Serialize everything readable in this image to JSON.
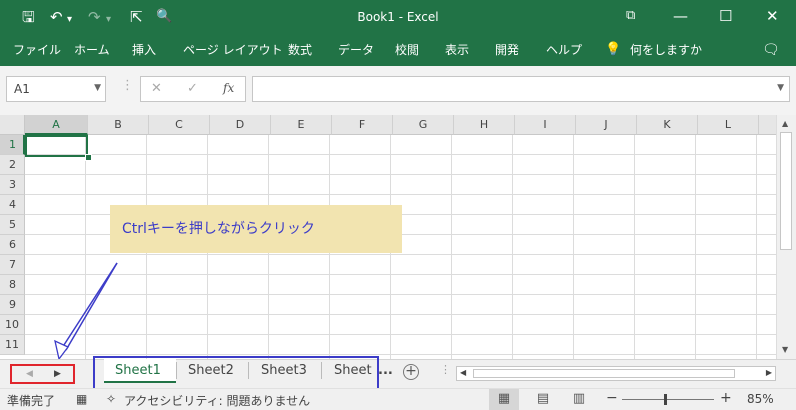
{
  "window": {
    "title": "Book1  -  Excel",
    "qa_icons": [
      "save-icon",
      "undo-icon",
      "undo-dropdown-icon",
      "redo-icon",
      "redo-dropdown-icon",
      "touch-mode-icon",
      "print-preview-icon"
    ],
    "qa_glyphs": {
      "save": "🖫",
      "undo": "↶",
      "undo_dd": "▾",
      "redo": "↷",
      "redo_dd": "▾",
      "touch": "⇱",
      "preview": "🔍"
    },
    "controls": {
      "restore": "⧉",
      "minimize": "—",
      "maximize": "☐",
      "close": "✕"
    }
  },
  "ribbon_tabs": [
    "ファイル",
    "ホーム",
    "挿入",
    "ページ レイアウト",
    "数式",
    "データ",
    "校閲",
    "表示",
    "開発",
    "ヘルプ"
  ],
  "tell_me": {
    "icon": "💡",
    "label": "何をしますか"
  },
  "share_icon": "🗨",
  "formula_bar": {
    "name_box": "A1",
    "cancel": "✕",
    "enter": "✓",
    "fx": "fx",
    "content": ""
  },
  "columns": [
    "A",
    "B",
    "C",
    "D",
    "E",
    "F",
    "G",
    "H",
    "I",
    "J",
    "K",
    "L"
  ],
  "rows": [
    "1",
    "2",
    "3",
    "4",
    "5",
    "6",
    "7",
    "8",
    "9",
    "10",
    "11"
  ],
  "active_cell": "A1",
  "callout": {
    "text": "Ctrlキーを押しながらクリック",
    "color": "#3c3cc8",
    "background": "#f2e4b0"
  },
  "sheet_nav": {
    "prev": "◀",
    "next": "▶"
  },
  "sheets": [
    "Sheet1",
    "Sheet2",
    "Sheet3",
    "Sheet"
  ],
  "active_sheet": "Sheet1",
  "sheets_ellipsis": "...",
  "add_sheet": "+",
  "vdots": "⋮",
  "status": {
    "ready": "準備完了",
    "accessibility": "アクセシビリティ: 問題ありません",
    "zoom_minus": "−",
    "zoom_plus": "+",
    "zoom": "85%",
    "zoom_value": 0.85
  },
  "colors": {
    "brand": "#217346",
    "highlight_red": "#e0252c",
    "highlight_blue": "#3c3cc8"
  }
}
